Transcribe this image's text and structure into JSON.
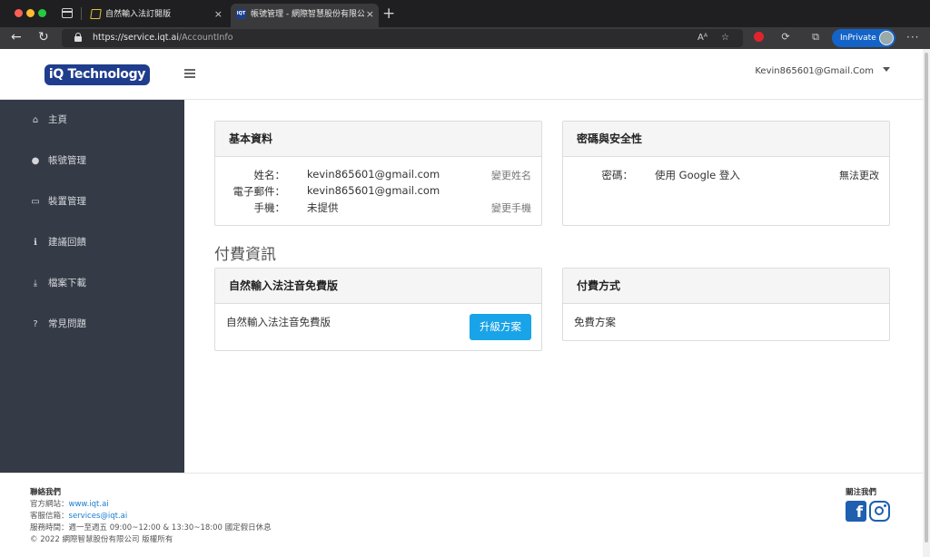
{
  "browser": {
    "tabs": [
      {
        "title": "自然輸入法訂閱版",
        "favicon": "document-icon",
        "active": false
      },
      {
        "title": "帳號管理 - 網際智慧股份有限公司",
        "favicon": "iqt-logo-icon",
        "active": true
      }
    ],
    "new_tab_glyph": "+",
    "close_glyph": "×",
    "url_host": "https://service.iqt.ai",
    "url_path": "/AccountInfo",
    "inprivate_label": "InPrivate",
    "read_aloud_glyph": "Aᴬ",
    "more_glyph": "···"
  },
  "header": {
    "logo_text": "iQ Technology",
    "user_email": "Kevin865601@Gmail.Com"
  },
  "sidebar": {
    "items": [
      {
        "label": "主頁",
        "icon": "home-icon",
        "glyph": "⌂"
      },
      {
        "label": "帳號管理",
        "icon": "user-icon",
        "glyph": "●"
      },
      {
        "label": "裝置管理",
        "icon": "laptop-icon",
        "glyph": "▭"
      },
      {
        "label": "建議回饋",
        "icon": "info-icon",
        "glyph": "ℹ"
      },
      {
        "label": "檔案下載",
        "icon": "download-icon",
        "glyph": "⤓"
      },
      {
        "label": "常見問題",
        "icon": "question-icon",
        "glyph": "?"
      }
    ]
  },
  "basic_info": {
    "title": "基本資料",
    "rows": [
      {
        "label": "姓名：",
        "value": "kevin865601@gmail.com",
        "action": "變更姓名"
      },
      {
        "label": "電子郵件：",
        "value": "kevin865601@gmail.com",
        "action": ""
      },
      {
        "label": "手機：",
        "value": "未提供",
        "action": "變更手機"
      }
    ]
  },
  "security": {
    "title": "密碼與安全性",
    "label": "密碼：",
    "value": "使用 Google 登入",
    "note": "無法更改"
  },
  "billing": {
    "section_title": "付費資訊",
    "plan_card_title": "自然輸入法注音免費版",
    "plan_name": "自然輸入法注音免費版",
    "upgrade_label": "升級方案",
    "payment_card_title": "付費方式",
    "payment_method": "免費方案"
  },
  "footer": {
    "contact_title": "聯絡我們",
    "website_label": "官方網站：",
    "website": "www.iqt.ai",
    "email_label": "客服信箱：",
    "email": "services@iqt.ai",
    "hours": "服務時間：週一至週五 09:00~12:00 & 13:30~18:00 國定假日休息",
    "copyright": "© 2022 網際智慧股份有限公司 版權所有",
    "follow_title": "關注我們",
    "facebook_glyph": "f"
  }
}
